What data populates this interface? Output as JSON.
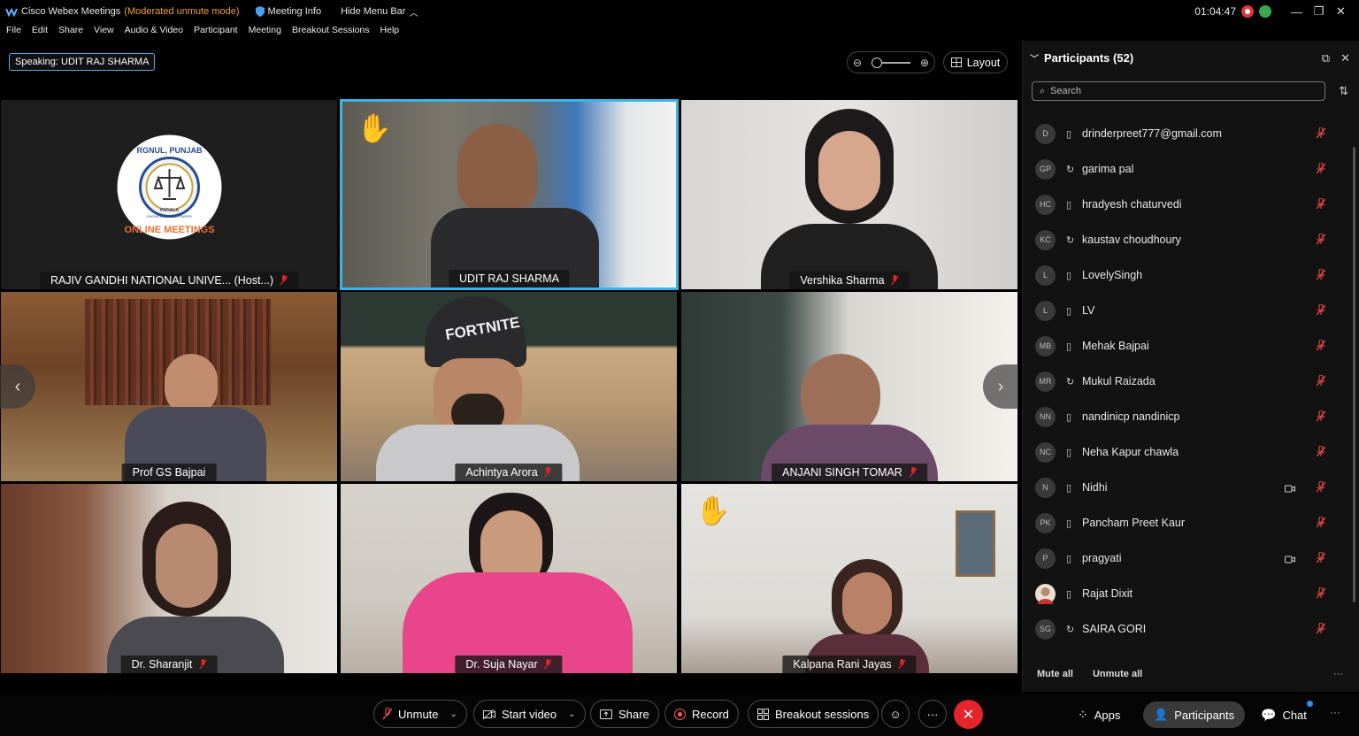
{
  "titlebar": {
    "app_name": "Cisco Webex Meetings",
    "mode": "(Moderated unmute mode)",
    "meeting_info": "Meeting Info",
    "hide_menu": "Hide Menu Bar",
    "clock": "01:04:47",
    "accent_color": "#f0a03c"
  },
  "menu": [
    "File",
    "Edit",
    "Share",
    "View",
    "Audio & Video",
    "Participant",
    "Meeting",
    "Breakout Sessions",
    "Help"
  ],
  "speaking": {
    "label": "Speaking:",
    "name": "UDIT RAJ SHARMA"
  },
  "view": {
    "layout_label": "Layout"
  },
  "tiles": [
    {
      "name": "RAJIV GANDHI NATIONAL UNIVE... (Host...)",
      "logo_text_top": "RGNUL, PUNJAB",
      "logo_text_bottom": "ONLINE MEETINGS",
      "logo_text_inner": "PATIALA",
      "logo_motto": "KNOWLEDGE EMPOWERS",
      "muted": true
    },
    {
      "name": "UDIT RAJ SHARMA",
      "muted": false,
      "hand_raised": true,
      "active": true
    },
    {
      "name": "Vershika Sharma",
      "muted": true
    },
    {
      "name": "Prof GS Bajpai",
      "muted": false
    },
    {
      "name": "Achintya Arora",
      "muted": true,
      "cap_text": "FORTNITE"
    },
    {
      "name": "ANJANI SINGH TOMAR",
      "muted": true
    },
    {
      "name": "Dr. Sharanjit",
      "muted": true
    },
    {
      "name": "Dr. Suja Nayar",
      "muted": true
    },
    {
      "name": "Kalpana Rani Jayas",
      "muted": true,
      "hand_raised": true
    }
  ],
  "participants": {
    "title": "Participants (52)",
    "search_placeholder": "Search",
    "list": [
      {
        "initials": "D",
        "name": "drinderpreet777@gmail.com",
        "device": "phone",
        "video": false
      },
      {
        "initials": "GP",
        "name": "garima pal",
        "device": "sync",
        "video": false
      },
      {
        "initials": "HC",
        "name": "hradyesh chaturvedi",
        "device": "phone",
        "video": false
      },
      {
        "initials": "KC",
        "name": "kaustav choudhoury",
        "device": "sync",
        "video": false
      },
      {
        "initials": "L",
        "name": "LovelySingh",
        "device": "phone",
        "video": false
      },
      {
        "initials": "L",
        "name": "LV",
        "device": "phone",
        "video": false
      },
      {
        "initials": "MB",
        "name": "Mehak Bajpai",
        "device": "phone",
        "video": false
      },
      {
        "initials": "MR",
        "name": "Mukul Raizada",
        "device": "sync",
        "video": false
      },
      {
        "initials": "NN",
        "name": "nandinicp nandinicp",
        "device": "phone",
        "video": false
      },
      {
        "initials": "NC",
        "name": "Neha Kapur chawla",
        "device": "phone",
        "video": false
      },
      {
        "initials": "N",
        "name": "Nidhi",
        "device": "phone",
        "video": true
      },
      {
        "initials": "PK",
        "name": "Pancham Preet Kaur",
        "device": "phone",
        "video": false
      },
      {
        "initials": "P",
        "name": "pragyati",
        "device": "phone",
        "video": true
      },
      {
        "initials": "",
        "name": "Rajat Dixit",
        "device": "phone",
        "video": false,
        "photo": true
      },
      {
        "initials": "SG",
        "name": "SAIRA GORI",
        "device": "sync",
        "video": false
      }
    ],
    "mute_all": "Mute all",
    "unmute_all": "Unmute all"
  },
  "toolbar": {
    "unmute": "Unmute",
    "start_video": "Start video",
    "share": "Share",
    "record": "Record",
    "breakout": "Breakout sessions",
    "apps": "Apps",
    "participants": "Participants",
    "chat": "Chat",
    "end_color": "#e3242b"
  }
}
